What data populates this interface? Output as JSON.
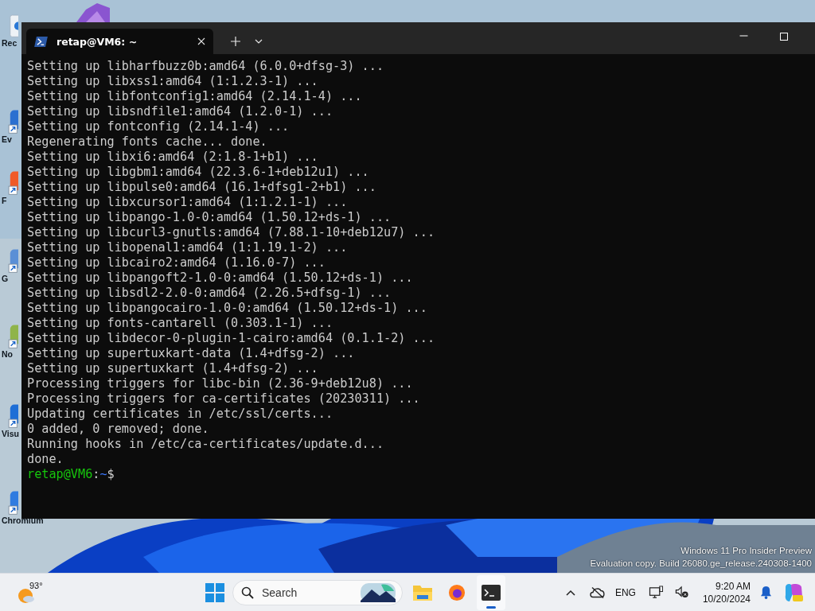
{
  "desktop": {
    "icons": [
      {
        "kind": "bin",
        "label": "Rec"
      },
      {
        "kind": "shortcut",
        "label": "Ev"
      },
      {
        "kind": "shortcut",
        "label": "F"
      },
      {
        "kind": "shortcut",
        "label": "G"
      },
      {
        "kind": "shortcut",
        "label": "No"
      },
      {
        "kind": "shortcut",
        "label": "Visu"
      },
      {
        "kind": "shortcut",
        "label": "Chromium"
      }
    ],
    "watermark": [
      "Windows 11 Pro Insider Preview",
      "Evaluation copy. Build 26080.ge_release.240308-1400"
    ]
  },
  "terminal": {
    "tabs": [
      {
        "title": "retap@VM6: ~",
        "selected": true
      }
    ],
    "lines": [
      "Setting up libharfbuzz0b:amd64 (6.0.0+dfsg-3) ...",
      "Setting up libxss1:amd64 (1:1.2.3-1) ...",
      "Setting up libfontconfig1:amd64 (2.14.1-4) ...",
      "Setting up libsndfile1:amd64 (1.2.0-1) ...",
      "Setting up fontconfig (2.14.1-4) ...",
      "Regenerating fonts cache... done.",
      "Setting up libxi6:amd64 (2:1.8-1+b1) ...",
      "Setting up libgbm1:amd64 (22.3.6-1+deb12u1) ...",
      "Setting up libpulse0:amd64 (16.1+dfsg1-2+b1) ...",
      "Setting up libxcursor1:amd64 (1:1.2.1-1) ...",
      "Setting up libpango-1.0-0:amd64 (1.50.12+ds-1) ...",
      "Setting up libcurl3-gnutls:amd64 (7.88.1-10+deb12u7) ...",
      "Setting up libopenal1:amd64 (1:1.19.1-2) ...",
      "Setting up libcairo2:amd64 (1.16.0-7) ...",
      "Setting up libpangoft2-1.0-0:amd64 (1.50.12+ds-1) ...",
      "Setting up libsdl2-2.0-0:amd64 (2.26.5+dfsg-1) ...",
      "Setting up libpangocairo-1.0-0:amd64 (1.50.12+ds-1) ...",
      "Setting up fonts-cantarell (0.303.1-1) ...",
      "Setting up libdecor-0-plugin-1-cairo:amd64 (0.1.1-2) ...",
      "Setting up supertuxkart-data (1.4+dfsg-2) ...",
      "Setting up supertuxkart (1.4+dfsg-2) ...",
      "Processing triggers for libc-bin (2.36-9+deb12u8) ...",
      "Processing triggers for ca-certificates (20230311) ...",
      "Updating certificates in /etc/ssl/certs...",
      "0 added, 0 removed; done.",
      "Running hooks in /etc/ca-certificates/update.d...",
      "done."
    ],
    "prompt": {
      "user": "retap@VM6",
      "separator": ":",
      "path": "~",
      "symbol": "$"
    }
  },
  "taskbar": {
    "weather": {
      "temperature": "93°"
    },
    "search": {
      "placeholder": "Search"
    },
    "apps": [
      {
        "kind": "explorer",
        "active": false
      },
      {
        "kind": "firefox",
        "active": false
      },
      {
        "kind": "terminal",
        "active": true
      }
    ],
    "tray": {
      "language": "ENG",
      "time": "9:20 AM",
      "date": "10/20/2024"
    }
  }
}
